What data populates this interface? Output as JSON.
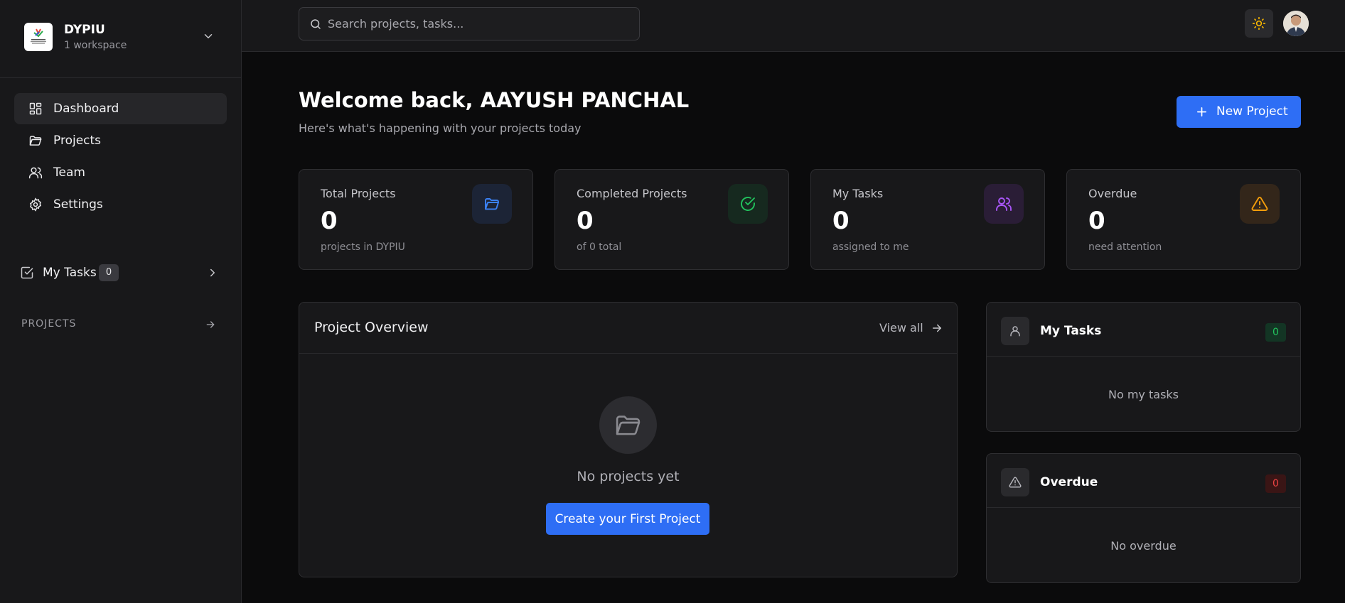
{
  "workspace": {
    "name": "DYPIU",
    "subtitle": "1 workspace"
  },
  "sidebar": {
    "nav": [
      {
        "label": "Dashboard",
        "icon": "dashboard-icon",
        "active": true
      },
      {
        "label": "Projects",
        "icon": "folder-icon"
      },
      {
        "label": "Team",
        "icon": "users-icon"
      },
      {
        "label": "Settings",
        "icon": "gear-icon"
      }
    ],
    "my_tasks": {
      "label": "My Tasks",
      "count": "0"
    },
    "projects_heading": "PROJECTS"
  },
  "topbar": {
    "search_placeholder": "Search projects, tasks..."
  },
  "header": {
    "welcome": "Welcome back, AAYUSH PANCHAL",
    "subtitle": "Here's what's happening with your projects today",
    "new_project_label": "New Project"
  },
  "stats": [
    {
      "title": "Total Projects",
      "value": "0",
      "sub": "projects in DYPIU",
      "icon": "folder-open-icon",
      "color": "#3b82f6"
    },
    {
      "title": "Completed Projects",
      "value": "0",
      "sub": "of 0 total",
      "icon": "check-circle-icon",
      "color": "#22c55e"
    },
    {
      "title": "My Tasks",
      "value": "0",
      "sub": "assigned to me",
      "icon": "users-icon",
      "color": "#a855f7"
    },
    {
      "title": "Overdue",
      "value": "0",
      "sub": "need attention",
      "icon": "warning-icon",
      "color": "#f59e0b"
    }
  ],
  "overview": {
    "title": "Project Overview",
    "view_all": "View all",
    "empty_text": "No projects yet",
    "create_label": "Create your First Project"
  },
  "panels": {
    "my_tasks": {
      "title": "My Tasks",
      "count": "0",
      "empty": "No my tasks"
    },
    "overdue": {
      "title": "Overdue",
      "count": "0",
      "empty": "No overdue"
    }
  },
  "colors": {
    "accent": "#2e6ef5",
    "success": "#22c55e",
    "danger": "#ef4444"
  }
}
